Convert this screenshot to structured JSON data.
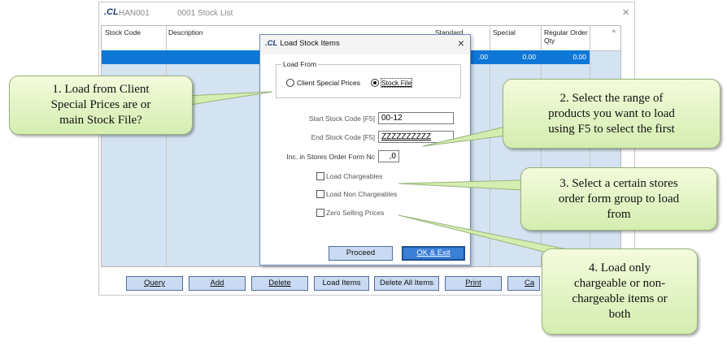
{
  "window": {
    "logo": ".CL",
    "app_code": "HAN001",
    "title": "0001  Stock List",
    "close": "×"
  },
  "grid": {
    "columns": [
      "Stock Code",
      "Description",
      "Standard",
      "Special",
      "Regular Order Qty"
    ],
    "row": {
      "standard": ".00",
      "special": "0.00",
      "regular": "0.00"
    },
    "scroll_up": "^"
  },
  "buttons": [
    "Query",
    "Add",
    "Delete",
    "Load Items",
    "Delete All Items",
    "Print",
    "Ca"
  ],
  "dialog": {
    "logo": ".CL",
    "title": "Load Stock Items",
    "close": "×",
    "load_from_label": "Load From",
    "radio_client": "Client Special Prices",
    "radio_stock": "Stock File",
    "selected": "stock",
    "start_label": "Start Stock Code [F5]",
    "start_value": "00-12",
    "end_label": "End Stock Code [F5]",
    "end_value": "ZZZZZZZZZZ",
    "inc_label": "Inc. in Stores Order Form Nc",
    "inc_value": ",0",
    "chk_chargeables": "Load Chargeables",
    "chk_non_chargeables": "Load Non Chargeables",
    "chk_zero": "Zero Selling Prices",
    "proceed": "Proceed",
    "ok_exit": "OK & Exit"
  },
  "callouts": {
    "c1": "1. Load from Client\nSpecial Prices are or\nmain Stock File?",
    "c2": "2. Select the range of\nproducts you want to load\nusing F5 to select the first",
    "c3": "3. Select a certain stores\norder form group to load\nfrom",
    "c4": "4. Load only\nchargeable or non-\nchargeable items or\nboth"
  },
  "colors": {
    "selection": "#0f78d7",
    "callout_fill": "#d4edb0",
    "button_fill": "#c9daf2"
  }
}
